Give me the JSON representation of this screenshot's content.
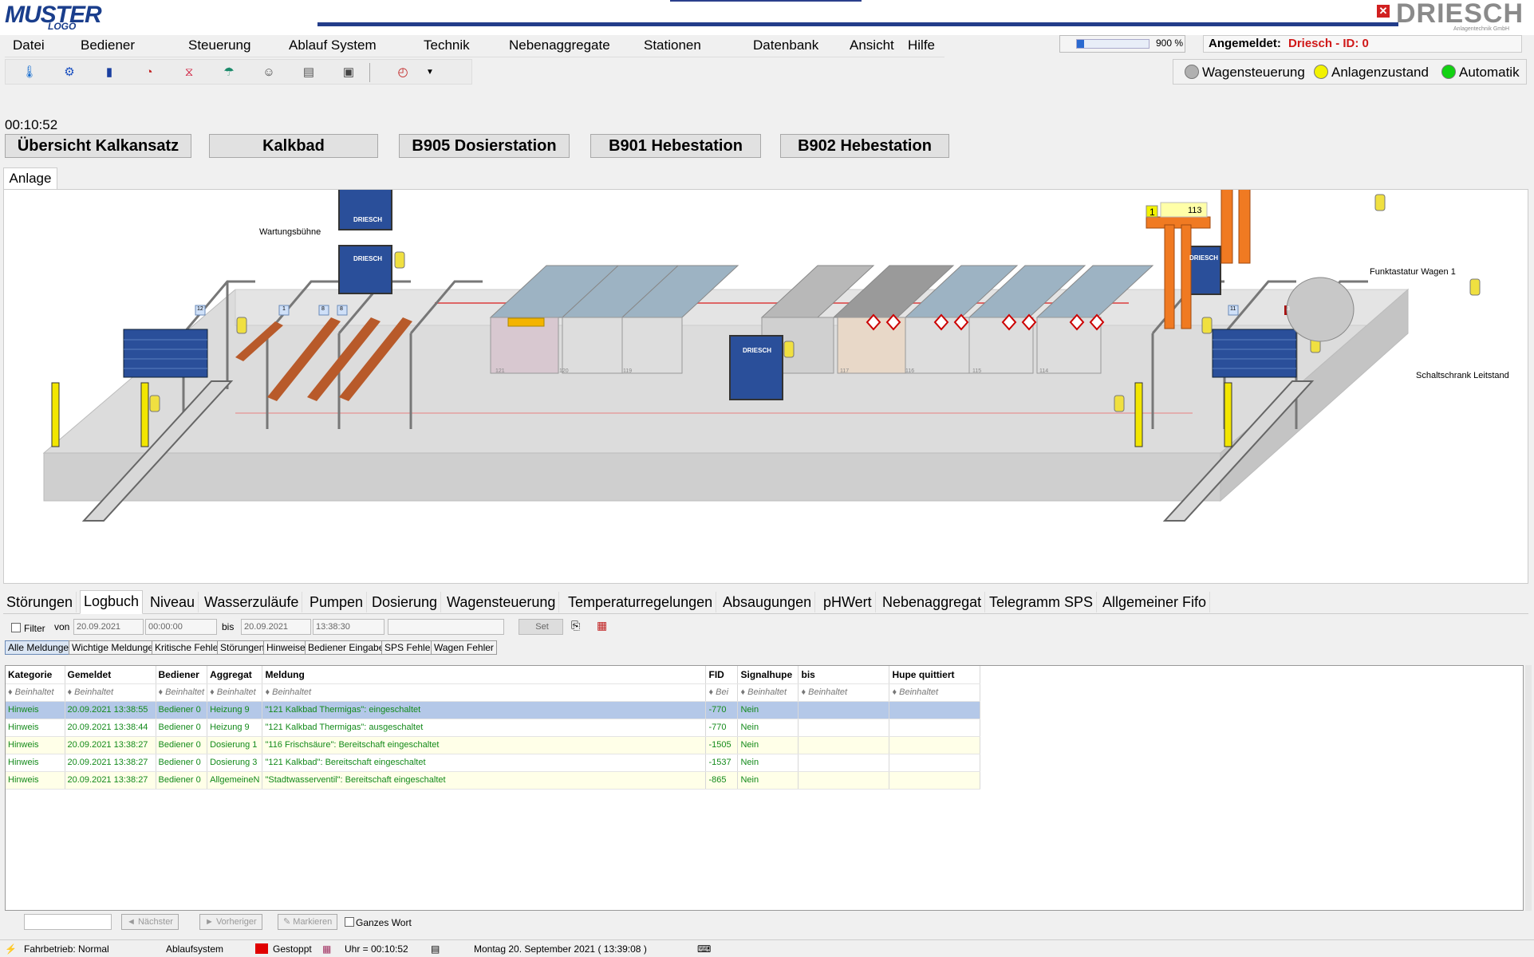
{
  "header": {
    "logo_left": "MUSTER",
    "logo_left_sub": "LOGO",
    "logo_right": "DRIESCH",
    "logo_right_sub": "Anlagentechnik GmbH"
  },
  "menu": [
    "Datei",
    "Bediener",
    "Steuerung",
    "Ablauf System",
    "Technik",
    "Nebenaggregate",
    "Stationen",
    "Datenbank",
    "Ansicht",
    "Hilfe"
  ],
  "toolbar_icons": [
    "thermometer-icon",
    "pump-icon",
    "tank-icon",
    "gauge-icon",
    "valve-icon",
    "shower-icon",
    "operator-icon",
    "chart-icon",
    "window-icon",
    "clock-icon",
    "dropdown-arrow-icon"
  ],
  "zoom": {
    "value": "900 %",
    "level_fraction": 0.1
  },
  "login": {
    "label": "Angemeldet:",
    "value": "Driesch - ID: 0"
  },
  "status_indicators": [
    {
      "label": "Wagensteuerung",
      "color": "#b0b0b0"
    },
    {
      "label": "Anlagenzustand",
      "color": "#f2f200"
    },
    {
      "label": "Automatik",
      "color": "#12d212"
    }
  ],
  "clock": "00:10:52",
  "station_buttons": [
    "Übersicht Kalkansatz",
    "Kalkbad",
    "B905 Dosierstation",
    "B901 Hebestation",
    "B902 Hebestation"
  ],
  "view_tab": "Anlage",
  "scene": {
    "labels": {
      "wartung": "Wartungsbühne",
      "funktastatur": "Funktastatur Wagen 1",
      "schaltschrank": "Schaltschrank Leitstand",
      "door_brand": "DRIESCH",
      "carrier_number": "1",
      "carrier_position": "113"
    },
    "tank_numbers": [
      "121",
      "120",
      "119",
      "117",
      "116",
      "115",
      "114"
    ],
    "small_numbers": [
      "12",
      "1",
      "8",
      "8",
      "11",
      "3"
    ]
  },
  "bottom_tabs": [
    "Störungen",
    "Logbuch",
    "Niveau",
    "Wasserzuläufe",
    "Pumpen",
    "Dosierung",
    "Wagensteuerung",
    "Temperaturregelungen",
    "Absaugungen",
    "pHWert",
    "Nebenaggregat",
    "Telegramm SPS",
    "Allgemeiner Fifo"
  ],
  "active_bottom_tab": "Logbuch",
  "filter": {
    "checkbox_label": "Filter",
    "von_label": "von",
    "von_date": "20.09.2021",
    "von_time": "00:00:00",
    "bis_label": "bis",
    "bis_date": "20.09.2021",
    "bis_time": "13:38:30",
    "set_label": "Set"
  },
  "sub_tabs": [
    "Alle Meldungen",
    "Wichtige Meldungen",
    "Kritische Fehler",
    "Störungen",
    "Hinweise",
    "Bediener Eingaben",
    "SPS Fehler",
    "Wagen Fehler"
  ],
  "grid": {
    "columns": [
      "Kategorie",
      "Gemeldet",
      "Bediener",
      "Aggregat",
      "Meldung",
      "FID",
      "Signalhupe",
      "bis",
      "Hupe quittiert"
    ],
    "filter_text": "Beinhaltet",
    "filter_short": "Bei",
    "rows": [
      [
        "Hinweis",
        "20.09.2021 13:38:55",
        "Bediener 0",
        "Heizung 9",
        "\"121 Kalkbad Thermigas\":  eingeschaltet",
        "-770",
        "Nein",
        "",
        ""
      ],
      [
        "Hinweis",
        "20.09.2021 13:38:44",
        "Bediener 0",
        "Heizung 9",
        "\"121 Kalkbad Thermigas\":  ausgeschaltet",
        "-770",
        "Nein",
        "",
        ""
      ],
      [
        "Hinweis",
        "20.09.2021 13:38:27",
        "Bediener 0",
        "Dosierung 1",
        "\"116 Frischsäure\":  Bereitschaft eingeschaltet",
        "-1505",
        "Nein",
        "",
        ""
      ],
      [
        "Hinweis",
        "20.09.2021 13:38:27",
        "Bediener 0",
        "Dosierung 3",
        "\"121 Kalkbad\":  Bereitschaft eingeschaltet",
        "-1537",
        "Nein",
        "",
        ""
      ],
      [
        "Hinweis",
        "20.09.2021 13:38:27",
        "Bediener 0",
        "AllgemeineN",
        "\"Stadtwasserventil\":  Bereitschaft eingeschaltet",
        "-865",
        "Nein",
        "",
        ""
      ]
    ]
  },
  "search": {
    "next": "Nächster",
    "prev": "Vorheriger",
    "mark": "Markieren",
    "whole_word": "Ganzes Wort"
  },
  "statusbar": {
    "fahrbetrieb": "Fahrbetrieb: Normal",
    "ablauf": "Ablaufsystem",
    "gestoppt": "Gestoppt",
    "uhr": "Uhr = 00:10:52",
    "datum": "Montag  20. September 2021  ( 13:39:08 )"
  }
}
